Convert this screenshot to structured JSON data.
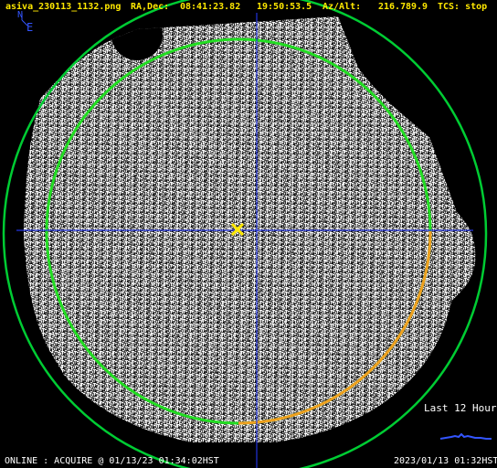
{
  "header": {
    "filename": "asiva_230113_1132.png",
    "radec_label": "RA,Dec:",
    "ra": "08:41:23.82",
    "dec": "19:50:53.5",
    "azalt_label": "Az/Alt:",
    "az": "216.7",
    "alt": "89.9",
    "tcs": "TCS: stop"
  },
  "compass": {
    "north": "N",
    "east": "E"
  },
  "trend": {
    "label": "Last 12 Hours",
    "line_color": "#3355ff"
  },
  "footer": {
    "status": "ONLINE : ACQUIRE @ 01/13/23 01:34:02HST",
    "date": "2023/01/13 01:32HST"
  },
  "overlay": {
    "horizon_color": "#00cc33",
    "inner_circle_color": "#22dd22",
    "arc_color": "#f0a020",
    "crosshair_color": "#2233dd",
    "target_color": "#ffe800",
    "header_text_color": "#ffe800"
  }
}
